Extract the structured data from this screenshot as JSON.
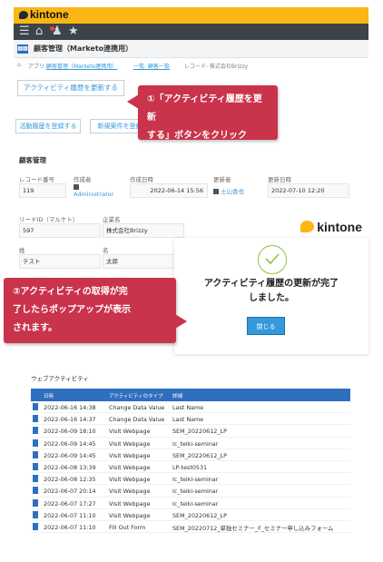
{
  "brand": {
    "name": "kintone"
  },
  "app": {
    "icon": "app-icon",
    "title": "顧客管理（Marketo連携用）"
  },
  "breadcrumb": [
    {
      "text": "アプリ:",
      "link": false
    },
    {
      "text": "顧客管理（Marketo連携用）",
      "link": true
    },
    {
      "text": "一覧: 顧客一覧",
      "link": true
    },
    {
      "text": "レコード: 株式会社Brizzy",
      "link": false
    }
  ],
  "buttons": {
    "update_activity": "アクティビティ履歴を更新する",
    "register_activity": "活動履歴を登録する",
    "register_opportunity": "新規案件を登録"
  },
  "section_title": "顧客管理",
  "fields": {
    "record_no_label": "レコード番号",
    "record_no": "119",
    "creator_label": "作成者",
    "creator": "Administrator",
    "created_label": "作成日時",
    "created": "2022-06-14 15:56",
    "updater_label": "更新者",
    "updater": "土山香也",
    "updated_label": "更新日時",
    "updated": "2022-07-10 12:20",
    "lead_id_label": "リードID（マルケト）",
    "lead_id": "597",
    "company_label": "企業名",
    "company": "株式会社Brizzy",
    "last_name_label": "姓",
    "last_name": "テスト",
    "first_name_label": "名",
    "first_name": "太郎"
  },
  "popup": {
    "logo_text": "kintone",
    "message_line1": "アクティビティ履歴の更新が完了",
    "message_line2": "しました。",
    "close_button": "閉じる"
  },
  "callouts": {
    "first_line1": "①「アクティビティ履歴を更新",
    "first_line2": "する」ボタンをクリック",
    "second_line1": "②アクティビティの取得が完",
    "second_line2": "了したらポップアップが表示",
    "second_line3": "されます。"
  },
  "web_activity": {
    "title": "ウェブアクティビティ",
    "columns": [
      "日時",
      "アクティビティのタイプ",
      "詳細"
    ],
    "rows": [
      {
        "date": "2022-06-16 14:38",
        "type": "Change Data Value",
        "detail": "Last Name"
      },
      {
        "date": "2022-06-16 14:37",
        "type": "Change Data Value",
        "detail": "Last Name"
      },
      {
        "date": "2022-06-09 18:10",
        "type": "Visit Webpage",
        "detail": "SEM_20220612_LP"
      },
      {
        "date": "2022-06-09 14:45",
        "type": "Visit Webpage",
        "detail": "lc_teiki-seminar"
      },
      {
        "date": "2022-06-09 14:45",
        "type": "Visit Webpage",
        "detail": "SEM_20220612_LP"
      },
      {
        "date": "2022-06-08 13:39",
        "type": "Visit Webpage",
        "detail": "LP-test0531"
      },
      {
        "date": "2022-06-08 12:35",
        "type": "Visit Webpage",
        "detail": "lc_teiki-seminar"
      },
      {
        "date": "2022-06-07 20:14",
        "type": "Visit Webpage",
        "detail": "lc_teiki-seminar"
      },
      {
        "date": "2022-06-07 17:27",
        "type": "Visit Webpage",
        "detail": "lc_teiki-seminar"
      },
      {
        "date": "2022-06-07 11:10",
        "type": "Visit Webpage",
        "detail": "SEM_20220612_LP"
      },
      {
        "date": "2022-06-07 11:10",
        "type": "Fill Out Form",
        "detail": "SEM_20220712_単独セミナー_F_セミナー申し込みフォーム"
      }
    ]
  },
  "colors": {
    "brand_yellow": "#fcb614",
    "nav_dark": "#3c4449",
    "link_blue": "#3498db",
    "callout_red": "#c9334b",
    "table_head": "#2f6fc0",
    "check_green": "#8fc33e"
  }
}
